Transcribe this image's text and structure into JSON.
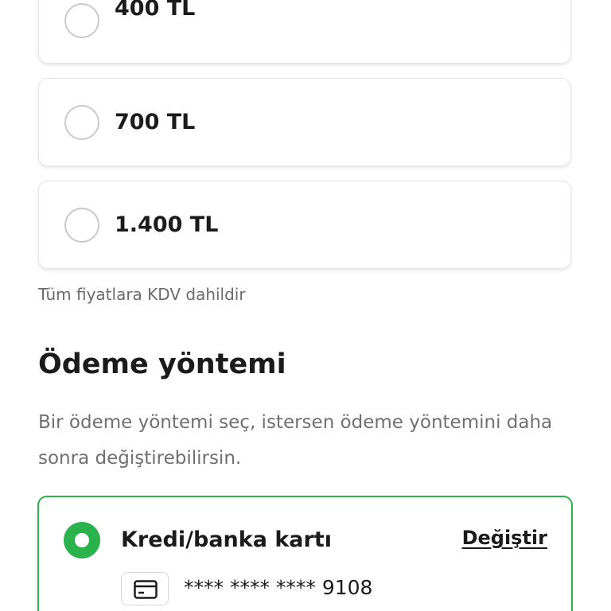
{
  "amount_options": [
    {
      "label": "400 TL",
      "selected": false
    },
    {
      "label": "700 TL",
      "selected": false
    },
    {
      "label": "1.400 TL",
      "selected": false
    }
  ],
  "vat_note": "Tüm fiyatlara KDV dahildir",
  "payment_section": {
    "title": "Ödeme yöntemi",
    "description": "Bir ödeme yöntemi seç, istersen ödeme yöntemini daha sonra değiştirebilirsin.",
    "method": {
      "label": "Kredi/banka kartı",
      "change_label": "Değiştir",
      "card_number": "**** **** **** 9108",
      "icon": "credit-card-icon",
      "selected": true
    }
  },
  "colors": {
    "accent_green": "#2bb24c",
    "text_primary": "#1b1b1b",
    "text_secondary": "#707070"
  }
}
